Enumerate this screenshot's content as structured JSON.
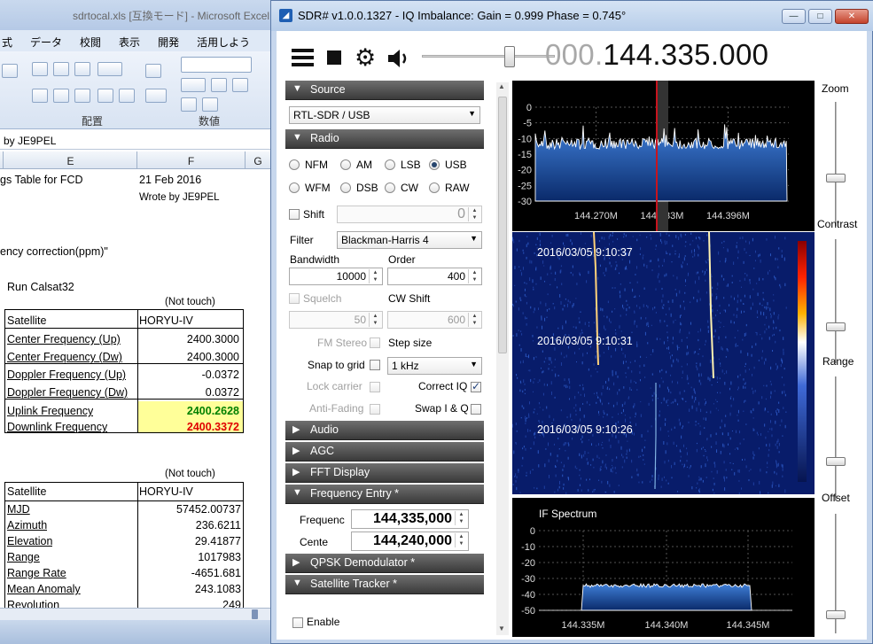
{
  "excel": {
    "title": "sdrtocal.xls  [互換モード] - Microsoft Excel",
    "tabs": [
      "式",
      "データ",
      "校閲",
      "表示",
      "開発",
      "活用しよう"
    ],
    "ribbon": {
      "group_haichi": "配置",
      "group_suuchi": "数値"
    },
    "formula_bar": "by JE9PEL",
    "columns": [
      "E",
      "F",
      "G"
    ],
    "rows": {
      "r1_e": "gs Table for FCD",
      "r1_f": "21 Feb 2016",
      "r2_f": "Wrote by JE9PEL",
      "r3_e": "ency correction(ppm)\"",
      "r4_e": "Run Calsat32",
      "not_touch_1": "(Not touch)",
      "t1": [
        {
          "label": "Satellite",
          "value": "HORYU-IV"
        },
        {
          "label": "Center Frequency (Up)",
          "value": "2400.3000"
        },
        {
          "label": "Center Frequency (Dw)",
          "value": "2400.3000"
        },
        {
          "label": "Doppler Frequency (Up)",
          "value": "-0.0372"
        },
        {
          "label": "Doppler Frequency (Dw)",
          "value": "0.0372"
        },
        {
          "label": "Uplink Frequency",
          "value": "2400.2628"
        },
        {
          "label": "Downlink Frequency",
          "value": "2400.3372"
        }
      ],
      "not_touch_2": "(Not touch)",
      "t2": [
        {
          "label": "Satellite",
          "value": "HORYU-IV"
        },
        {
          "label": "MJD",
          "value": "57452.00737"
        },
        {
          "label": "Azimuth",
          "value": "236.6211"
        },
        {
          "label": "Elevation",
          "value": "29.41877"
        },
        {
          "label": "Range",
          "value": "1017983"
        },
        {
          "label": "Range Rate",
          "value": "-4651.681"
        },
        {
          "label": "Mean Anomaly",
          "value": "243.1083"
        },
        {
          "label": "Revolution",
          "value": "249"
        }
      ]
    },
    "colors": {
      "uplink": "#008000",
      "downlink": "#e00000",
      "highlight": "#ffff99"
    }
  },
  "sdr": {
    "title": "SDR# v1.0.0.1327 - IQ Imbalance: Gain = 0.999 Phase = 0.745°",
    "window_buttons": {
      "minimize": "—",
      "maximize": "□",
      "close": "✕"
    },
    "frequency_prefix": "000.",
    "frequency_main": "144.335.000",
    "toolbar_icons": [
      "menu-icon",
      "stop-icon",
      "gear-icon",
      "speaker-icon"
    ],
    "sections": {
      "source": "Source",
      "radio": "Radio",
      "audio": "Audio",
      "agc": "AGC",
      "fft": "FFT Display",
      "freq_entry": "Frequency Entry *",
      "qpsk": "QPSK Demodulator *",
      "sat_tracker": "Satellite Tracker *"
    },
    "source": {
      "device": "RTL-SDR / USB"
    },
    "radio": {
      "modes": [
        "NFM",
        "AM",
        "LSB",
        "USB",
        "WFM",
        "DSB",
        "CW",
        "RAW"
      ],
      "selected_mode": "USB",
      "shift_label": "Shift",
      "shift_value": "0",
      "filter_label": "Filter",
      "filter_value": "Blackman-Harris 4",
      "bandwidth_label": "Bandwidth",
      "bandwidth_value": "10000",
      "order_label": "Order",
      "order_value": "400",
      "squelch_label": "Squelch",
      "squelch_value": "50",
      "cw_shift_label": "CW Shift",
      "cw_shift_value": "600",
      "fm_stereo": "FM Stereo",
      "step_size": "Step size",
      "snap_to_grid": "Snap to grid",
      "step_value": "1 kHz",
      "lock_carrier": "Lock carrier",
      "correct_iq": "Correct IQ",
      "anti_fading": "Anti-Fading",
      "swap_iq": "Swap I & Q"
    },
    "freq_entry": {
      "frequency_label": "Frequenc",
      "frequency_value": "144,335,000",
      "center_label": "Cente",
      "center_value": "144,240,000"
    },
    "enable_label": "Enable",
    "right_sliders": {
      "zoom": "Zoom",
      "contrast": "Contrast",
      "range": "Range",
      "offset": "Offset"
    },
    "spectrum": {
      "y_ticks": [
        "0",
        "-5",
        "-10",
        "-15",
        "-20",
        "-25",
        "-30"
      ],
      "x_ticks": [
        "144.270M",
        "144.333M",
        "144.396M"
      ]
    },
    "waterfall": {
      "timestamps": [
        "2016/03/05 9:10:37",
        "2016/03/05 9:10:31",
        "2016/03/05 9:10:26"
      ]
    },
    "if_spectrum": {
      "title": "IF Spectrum",
      "y_ticks": [
        "0",
        "-10",
        "-20",
        "-30",
        "-40",
        "-50"
      ],
      "x_ticks": [
        "144.335M",
        "144.340M",
        "144.345M"
      ]
    }
  }
}
